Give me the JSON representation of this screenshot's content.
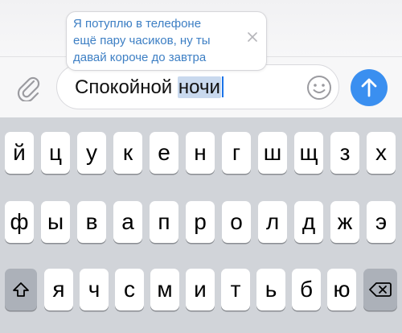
{
  "reply_popup": {
    "lines": [
      "Я потуплю в телефоне",
      "ещё пару часиков, ну ты",
      "давай короче до завтра"
    ],
    "close_icon": "close-x-icon"
  },
  "composer": {
    "text_plain": "Спокойной ",
    "text_selected": "ночи",
    "attach_icon": "paperclip-icon",
    "emoji_icon": "smiley-icon",
    "send_icon": "arrow-up-icon",
    "send_color": "#3a8ff0"
  },
  "keyboard": {
    "row1": [
      "й",
      "ц",
      "у",
      "к",
      "е",
      "н",
      "г",
      "ш",
      "щ",
      "з",
      "х"
    ],
    "row2": [
      "ф",
      "ы",
      "в",
      "а",
      "п",
      "р",
      "о",
      "л",
      "д",
      "ж",
      "э"
    ],
    "row3": [
      "я",
      "ч",
      "с",
      "м",
      "и",
      "т",
      "ь",
      "б",
      "ю"
    ],
    "shift_icon": "shift-arrow-icon",
    "backspace_icon": "backspace-icon"
  }
}
